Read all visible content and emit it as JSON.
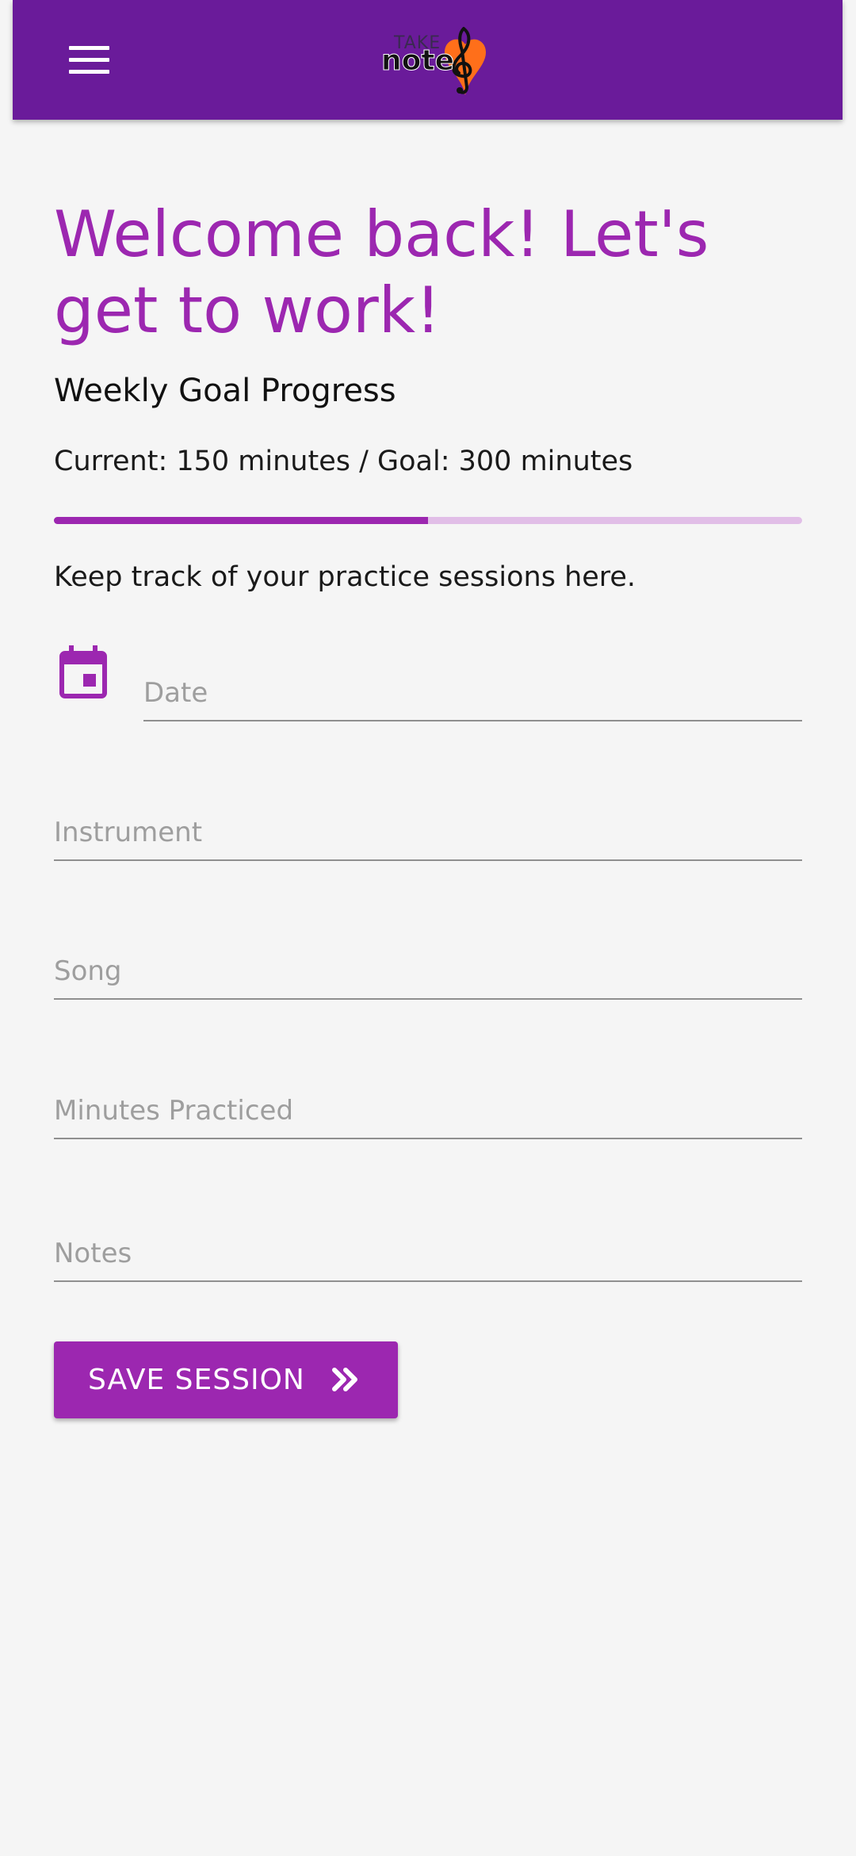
{
  "header": {
    "menu_icon": "hamburger-menu-icon",
    "logo": {
      "top_text": "TAKE",
      "main_text": "note",
      "icon": "treble-clef-heart-logo"
    },
    "colors": {
      "toolbar": "#6a1b9a",
      "logo_heart": "#ff6f1a"
    }
  },
  "main": {
    "welcome": "Welcome back! Let's get to work!",
    "goal_title": "Weekly Goal Progress",
    "goal_text": "Current: 150 minutes / Goal: 300 minutes",
    "progress_fraction": 0.5,
    "intro": "Keep track of your practice sessions here."
  },
  "form": {
    "date_icon": "calendar-icon",
    "date_placeholder": "Date",
    "instrument_placeholder": "Instrument",
    "song_placeholder": "Song",
    "minutes_placeholder": "Minutes Practiced",
    "notes_placeholder": "Notes",
    "save_label": "SAVE SESSION",
    "save_icon": "double-chevron-right-icon"
  },
  "colors": {
    "accent": "#9c27b0",
    "progress_track": "#e1bee7",
    "background": "#f5f5f5"
  }
}
